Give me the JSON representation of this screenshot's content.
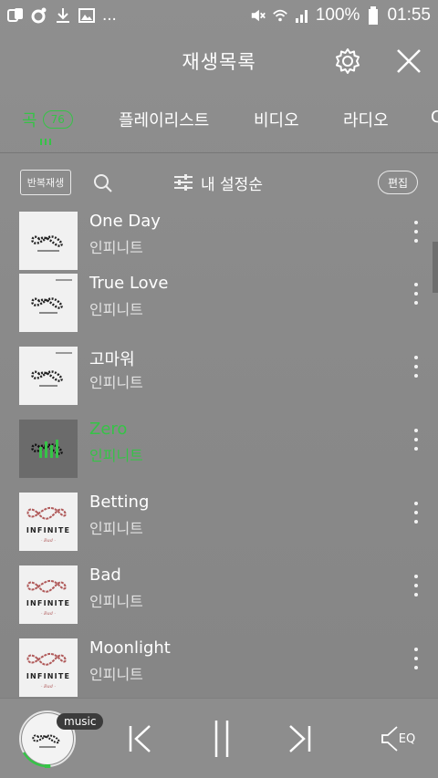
{
  "status_bar": {
    "battery": "100%",
    "time": "01:55",
    "left_icons": [
      "app-icon",
      "music-notification-icon",
      "download-icon",
      "image-icon"
    ],
    "more": "..."
  },
  "header": {
    "title": "재생목록",
    "settings_icon": "gear-icon",
    "close_icon": "close-icon"
  },
  "tabs": [
    {
      "label": "곡",
      "badge": "76",
      "active": true
    },
    {
      "label": "플레이리스트"
    },
    {
      "label": "비디오"
    },
    {
      "label": "라디오"
    },
    {
      "label": "C"
    }
  ],
  "toolbar": {
    "repeat_label": "반복재생",
    "sort_label": "내 설정순",
    "edit_label": "편집"
  },
  "songs": [
    {
      "title": "One Day",
      "artist": "인피니트",
      "active": false
    },
    {
      "title": "True Love",
      "artist": "인피니트",
      "active": false
    },
    {
      "title": "고마워",
      "artist": "인피니트",
      "active": false
    },
    {
      "title": "Zero",
      "artist": "인피니트",
      "active": true
    },
    {
      "title": "Betting",
      "artist": "인피니트",
      "active": false
    },
    {
      "title": "Bad",
      "artist": "인피니트",
      "active": false
    },
    {
      "title": "Moonlight",
      "artist": "인피니트",
      "active": false
    }
  ],
  "album_art_text": {
    "infinite": "INFINITE",
    "subtitle": "- Bad -"
  },
  "player": {
    "badge": "music",
    "eq_label": "EQ"
  },
  "colors": {
    "accent": "#36c347",
    "background": "#8e8e8e"
  }
}
